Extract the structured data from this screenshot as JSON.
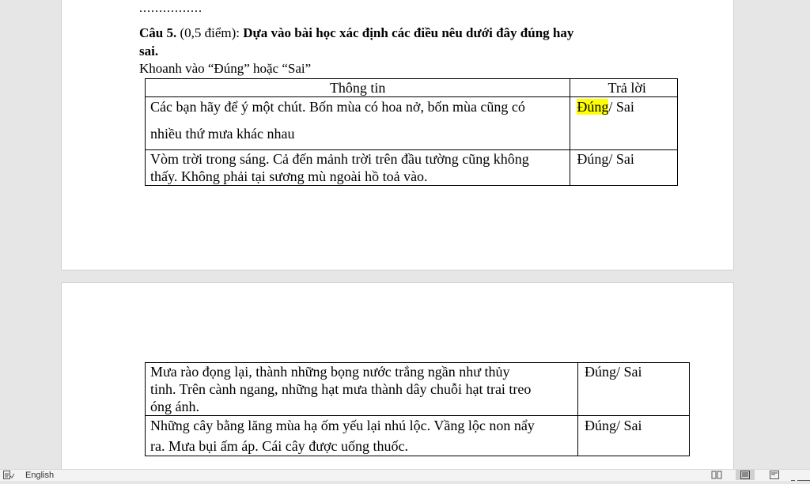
{
  "page1": {
    "dots": "................",
    "question_label": "Câu 5.",
    "question_points": " (0,5 điểm): ",
    "question_text_1": "Dựa vào bài học xác định các điều nêu dưới đây đúng hay",
    "question_text_2": "sai.",
    "instruction": "Khoanh vào “Đúng” hoặc “Sai”",
    "table": {
      "headers": [
        "Thông tin",
        "Trả lời"
      ],
      "rows": [
        {
          "line1": "Các bạn hãy để ý một chút. Bốn mùa có hoa nở, bốn mùa cũng có",
          "line2": "nhiều thứ mưa khác nhau",
          "answer_highlight": "Đúng",
          "answer_rest": "/ Sai"
        },
        {
          "line1": "Vòm trời trong sáng. Cả đến mảnh trời trên đầu tường cũng không",
          "line2": "thấy. Không phải tại sương mù ngoài hồ toả vào.",
          "answer": "Đúng/ Sai"
        }
      ]
    }
  },
  "page2": {
    "table": {
      "rows": [
        {
          "line1": "Mưa rào đọng lại, thành những bọng nước trắng ngần như thủy",
          "line2": "tinh. Trên cành ngang, những hạt mưa thành dây chuỗi hạt trai treo",
          "line3": "óng ánh.",
          "answer": "Đúng/ Sai"
        },
        {
          "line1": "Những cây bằng lăng mùa hạ ốm yếu lại nhú lộc. Vầng lộc non nẩy",
          "line2": "ra. Mưa bụi ấm áp. Cái cây được uống thuốc.",
          "answer": "Đúng/ Sai"
        }
      ]
    }
  },
  "status_bar": {
    "language": "English",
    "icons": [
      "proofing-icon",
      "read-mode-icon",
      "print-layout-icon",
      "web-layout-icon",
      "zoom-slider"
    ]
  }
}
